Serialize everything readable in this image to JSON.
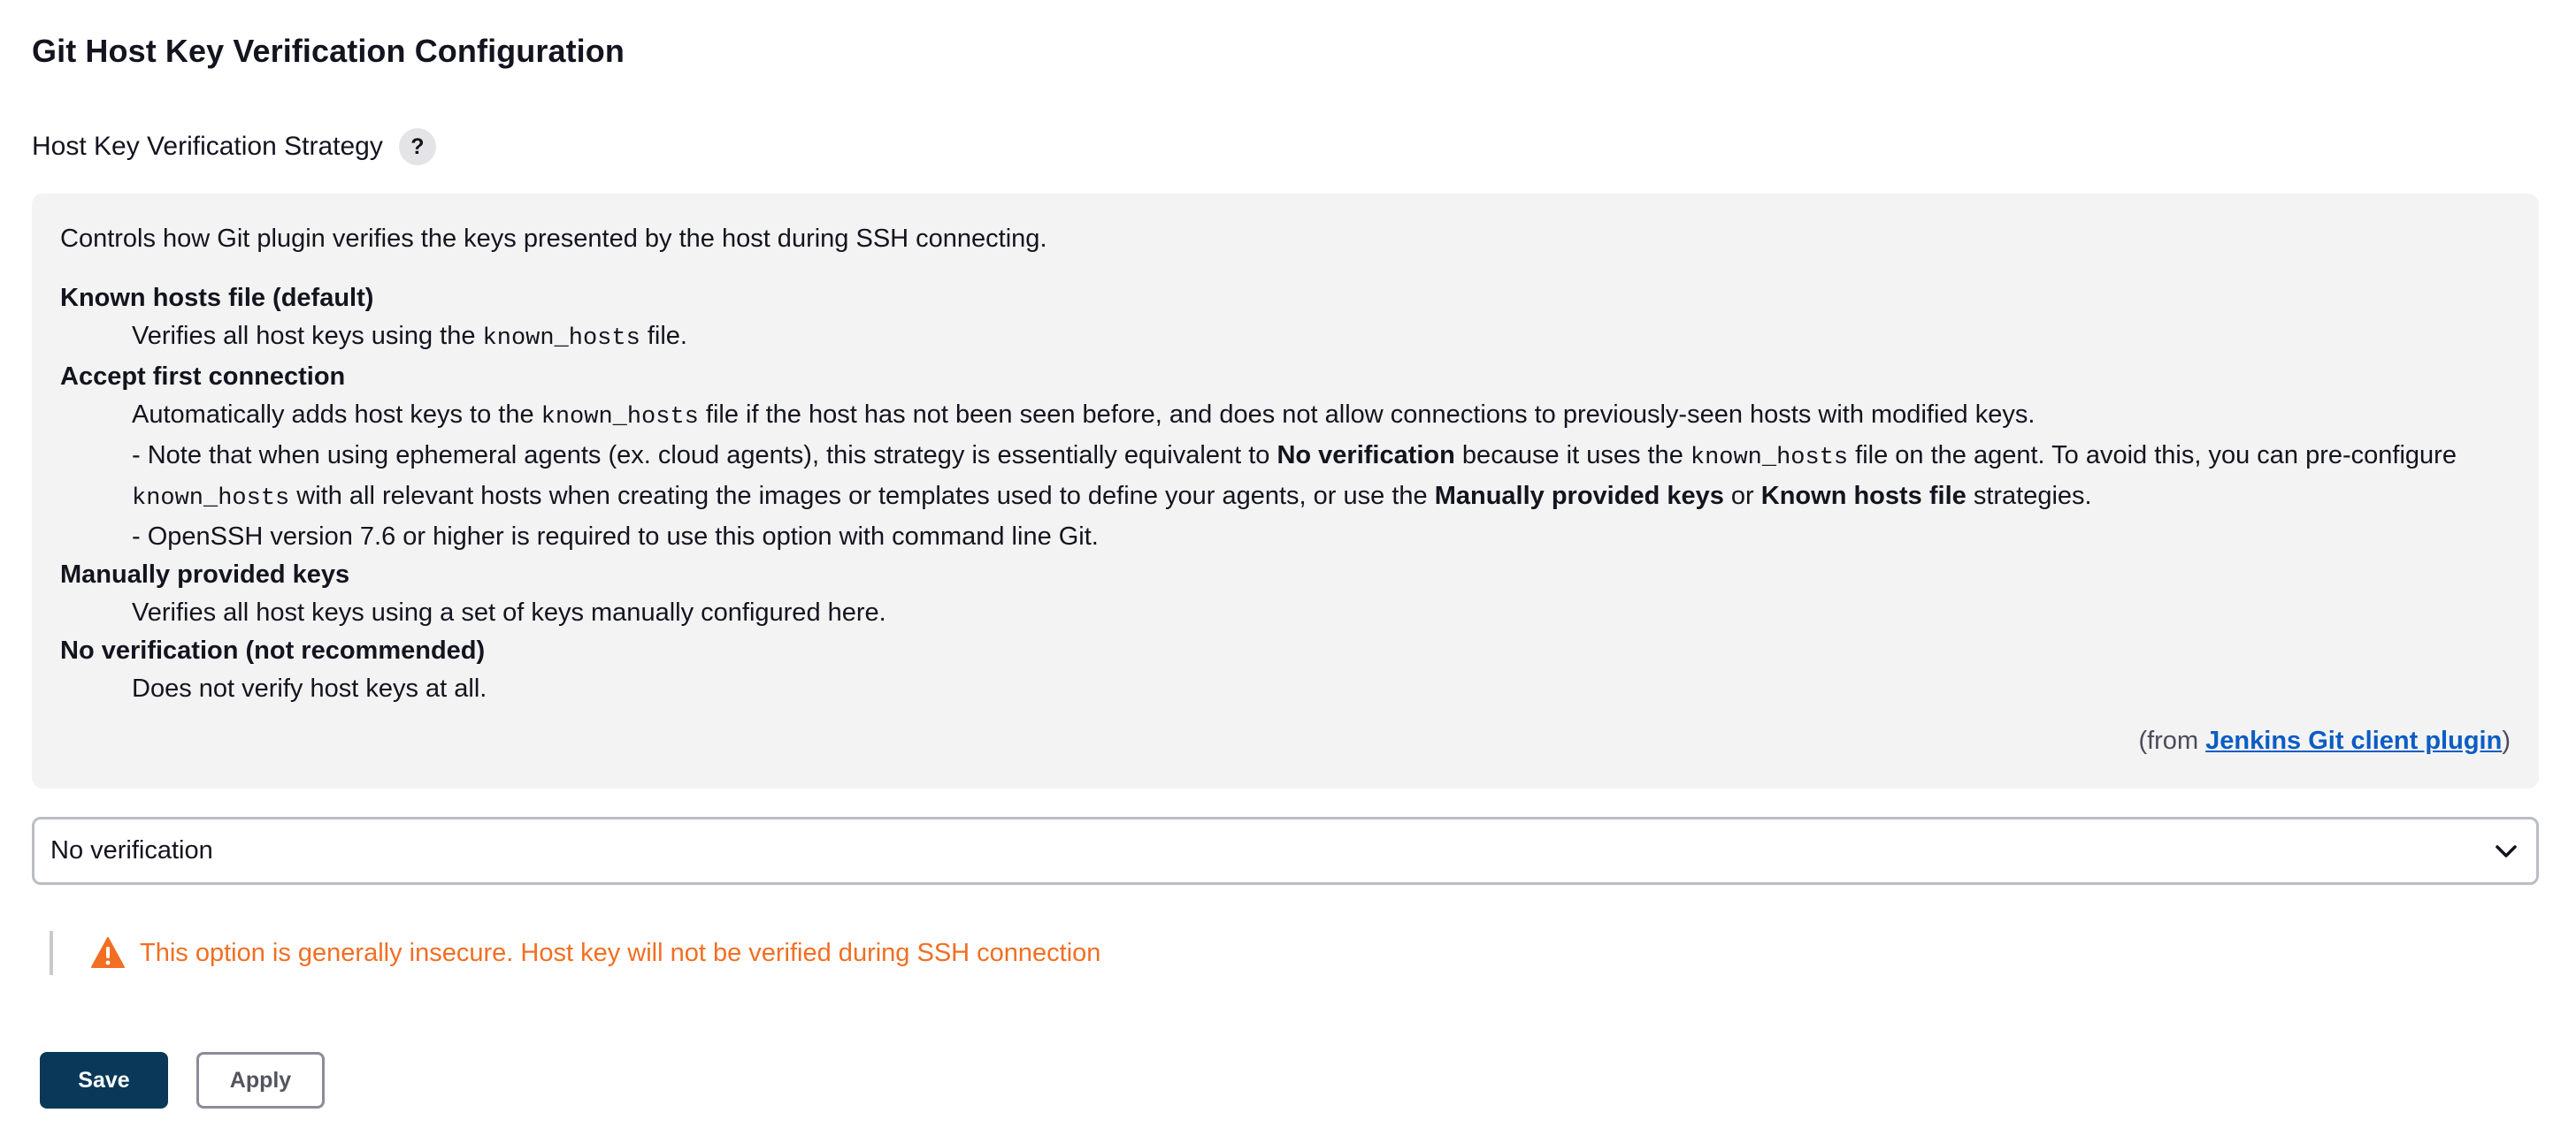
{
  "page": {
    "title": "Git Host Key Verification Configuration"
  },
  "field": {
    "label": "Host Key Verification Strategy",
    "help_glyph": "?"
  },
  "help": {
    "intro": "Controls how Git plugin verifies the keys presented by the host during SSH connecting.",
    "known_hosts_term": "Known hosts file (default)",
    "known_hosts_desc_pre": "Verifies all host keys using the ",
    "known_hosts_code": "known_hosts",
    "known_hosts_desc_post": " file.",
    "accept_term": "Accept first connection",
    "accept_line1_pre": "Automatically adds host keys to the ",
    "accept_line1_code": "known_hosts",
    "accept_line1_post": " file if the host has not been seen before, and does not allow connections to previously-seen hosts with modified keys.",
    "accept_note_pre": "- Note that when using ephemeral agents (ex. cloud agents), this strategy is essentially equivalent to ",
    "accept_note_bold1": "No verification",
    "accept_note_mid1": " because it uses the ",
    "accept_note_code1": "known_hosts",
    "accept_note_mid2": " file on the agent. To avoid this, you can pre-configure",
    "accept_note_code2": "known_hosts",
    "accept_note_mid3": " with all relevant hosts when creating the images or templates used to define your agents, or use the ",
    "accept_note_bold2": "Manually provided keys",
    "accept_note_or": " or ",
    "accept_note_bold3": "Known hosts file",
    "accept_note_end": " strategies.",
    "accept_openssh": "- OpenSSH version 7.6 or higher is required to use this option with command line Git.",
    "manual_term": "Manually provided keys",
    "manual_desc": "Verifies all host keys using a set of keys manually configured here.",
    "none_term": "No verification (not recommended)",
    "none_desc": "Does not verify host keys at all.",
    "from_prefix": "(from ",
    "from_link": "Jenkins Git client plugin",
    "from_suffix": ")"
  },
  "select": {
    "value": "No verification",
    "icon": "chevron-down-icon"
  },
  "warning": {
    "icon": "warning-icon",
    "text": "This option is generally insecure. Host key will not be verified during SSH connection",
    "color": "#f26e22"
  },
  "buttons": {
    "save": "Save",
    "apply": "Apply"
  },
  "colors": {
    "primary": "#093858",
    "link": "#0b5cc4",
    "panel_bg": "#f3f3f3"
  }
}
